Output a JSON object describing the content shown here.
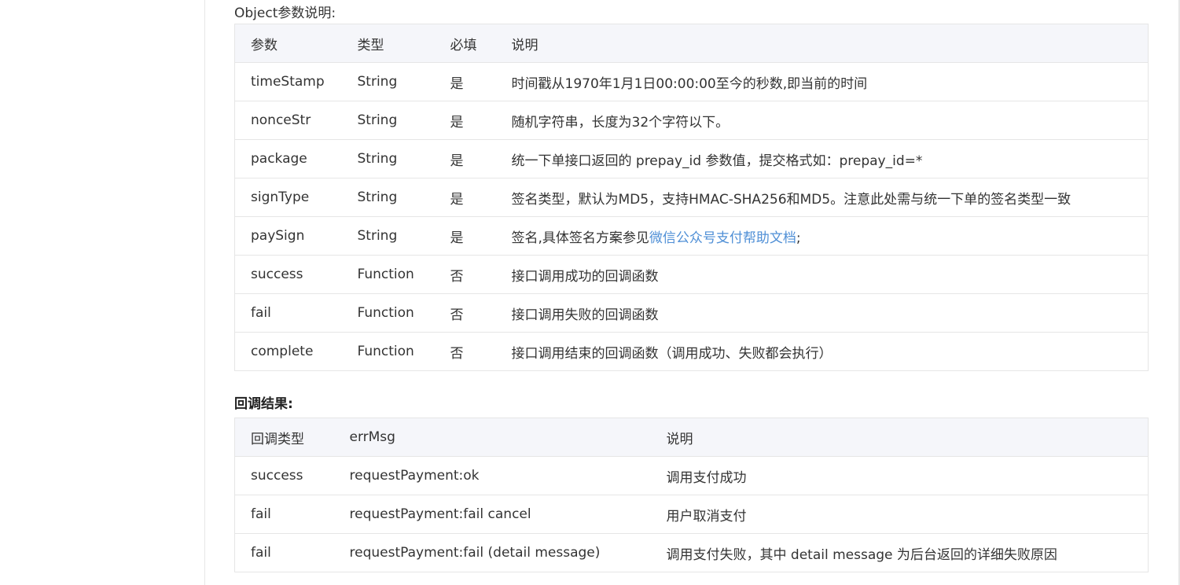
{
  "object_params": {
    "title": "Object参数说明:",
    "headers": [
      "参数",
      "类型",
      "必填",
      "说明"
    ],
    "rows": [
      {
        "param": "timeStamp",
        "type": "String",
        "required": "是",
        "desc": "时间戳从1970年1月1日00:00:00至今的秒数,即当前的时间"
      },
      {
        "param": "nonceStr",
        "type": "String",
        "required": "是",
        "desc": "随机字符串，长度为32个字符以下。"
      },
      {
        "param": "package",
        "type": "String",
        "required": "是",
        "desc": "统一下单接口返回的 prepay_id 参数值，提交格式如：prepay_id=*"
      },
      {
        "param": "signType",
        "type": "String",
        "required": "是",
        "desc": "签名类型，默认为MD5，支持HMAC-SHA256和MD5。注意此处需与统一下单的签名类型一致"
      },
      {
        "param": "paySign",
        "type": "String",
        "required": "是",
        "desc_prefix": "签名,具体签名方案参见",
        "desc_link": "微信公众号支付帮助文档",
        "desc_suffix": ";"
      },
      {
        "param": "success",
        "type": "Function",
        "required": "否",
        "desc": "接口调用成功的回调函数"
      },
      {
        "param": "fail",
        "type": "Function",
        "required": "否",
        "desc": "接口调用失败的回调函数"
      },
      {
        "param": "complete",
        "type": "Function",
        "required": "否",
        "desc": "接口调用结束的回调函数（调用成功、失败都会执行）"
      }
    ]
  },
  "callback_results": {
    "title": "回调结果:",
    "headers": [
      "回调类型",
      "errMsg",
      "说明"
    ],
    "rows": [
      {
        "type": "success",
        "errmsg": "requestPayment:ok",
        "desc": "调用支付成功"
      },
      {
        "type": "fail",
        "errmsg": "requestPayment:fail cancel",
        "desc": "用户取消支付"
      },
      {
        "type": "fail",
        "errmsg": "requestPayment:fail (detail message)",
        "desc": "调用支付失败，其中 detail message 为后台返回的详细失败原因"
      }
    ]
  },
  "colors": {
    "link": "#4f8fd6",
    "header_bg": "#f5f6fa",
    "border": "#e6e6e6"
  }
}
